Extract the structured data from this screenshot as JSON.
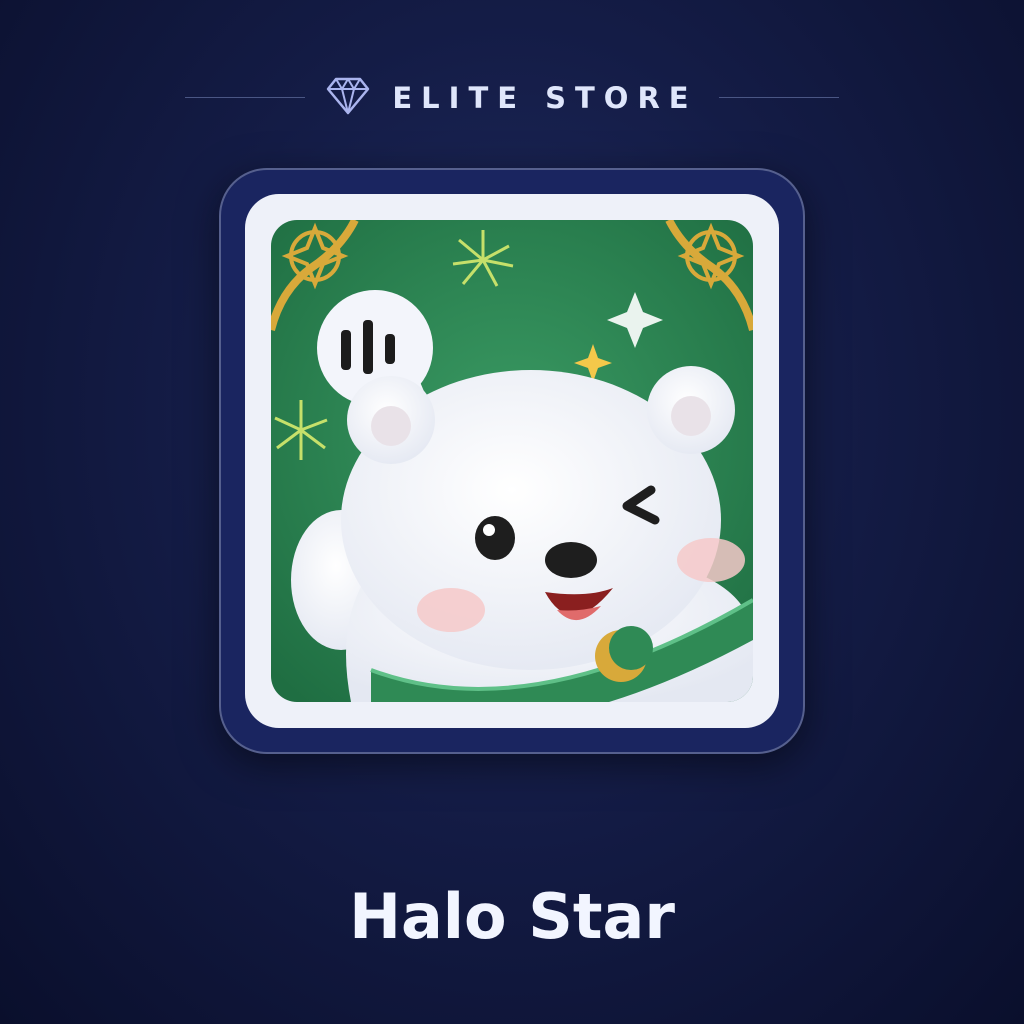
{
  "header": {
    "brand": "ELITE STORE",
    "icon": "diamond-icon"
  },
  "product": {
    "name": "Halo Star",
    "image": "polar-bear-app-icon",
    "colors": {
      "accent_green": "#2f8a55",
      "gold": "#d8a93a",
      "bear_white": "#f3f5fb"
    }
  }
}
